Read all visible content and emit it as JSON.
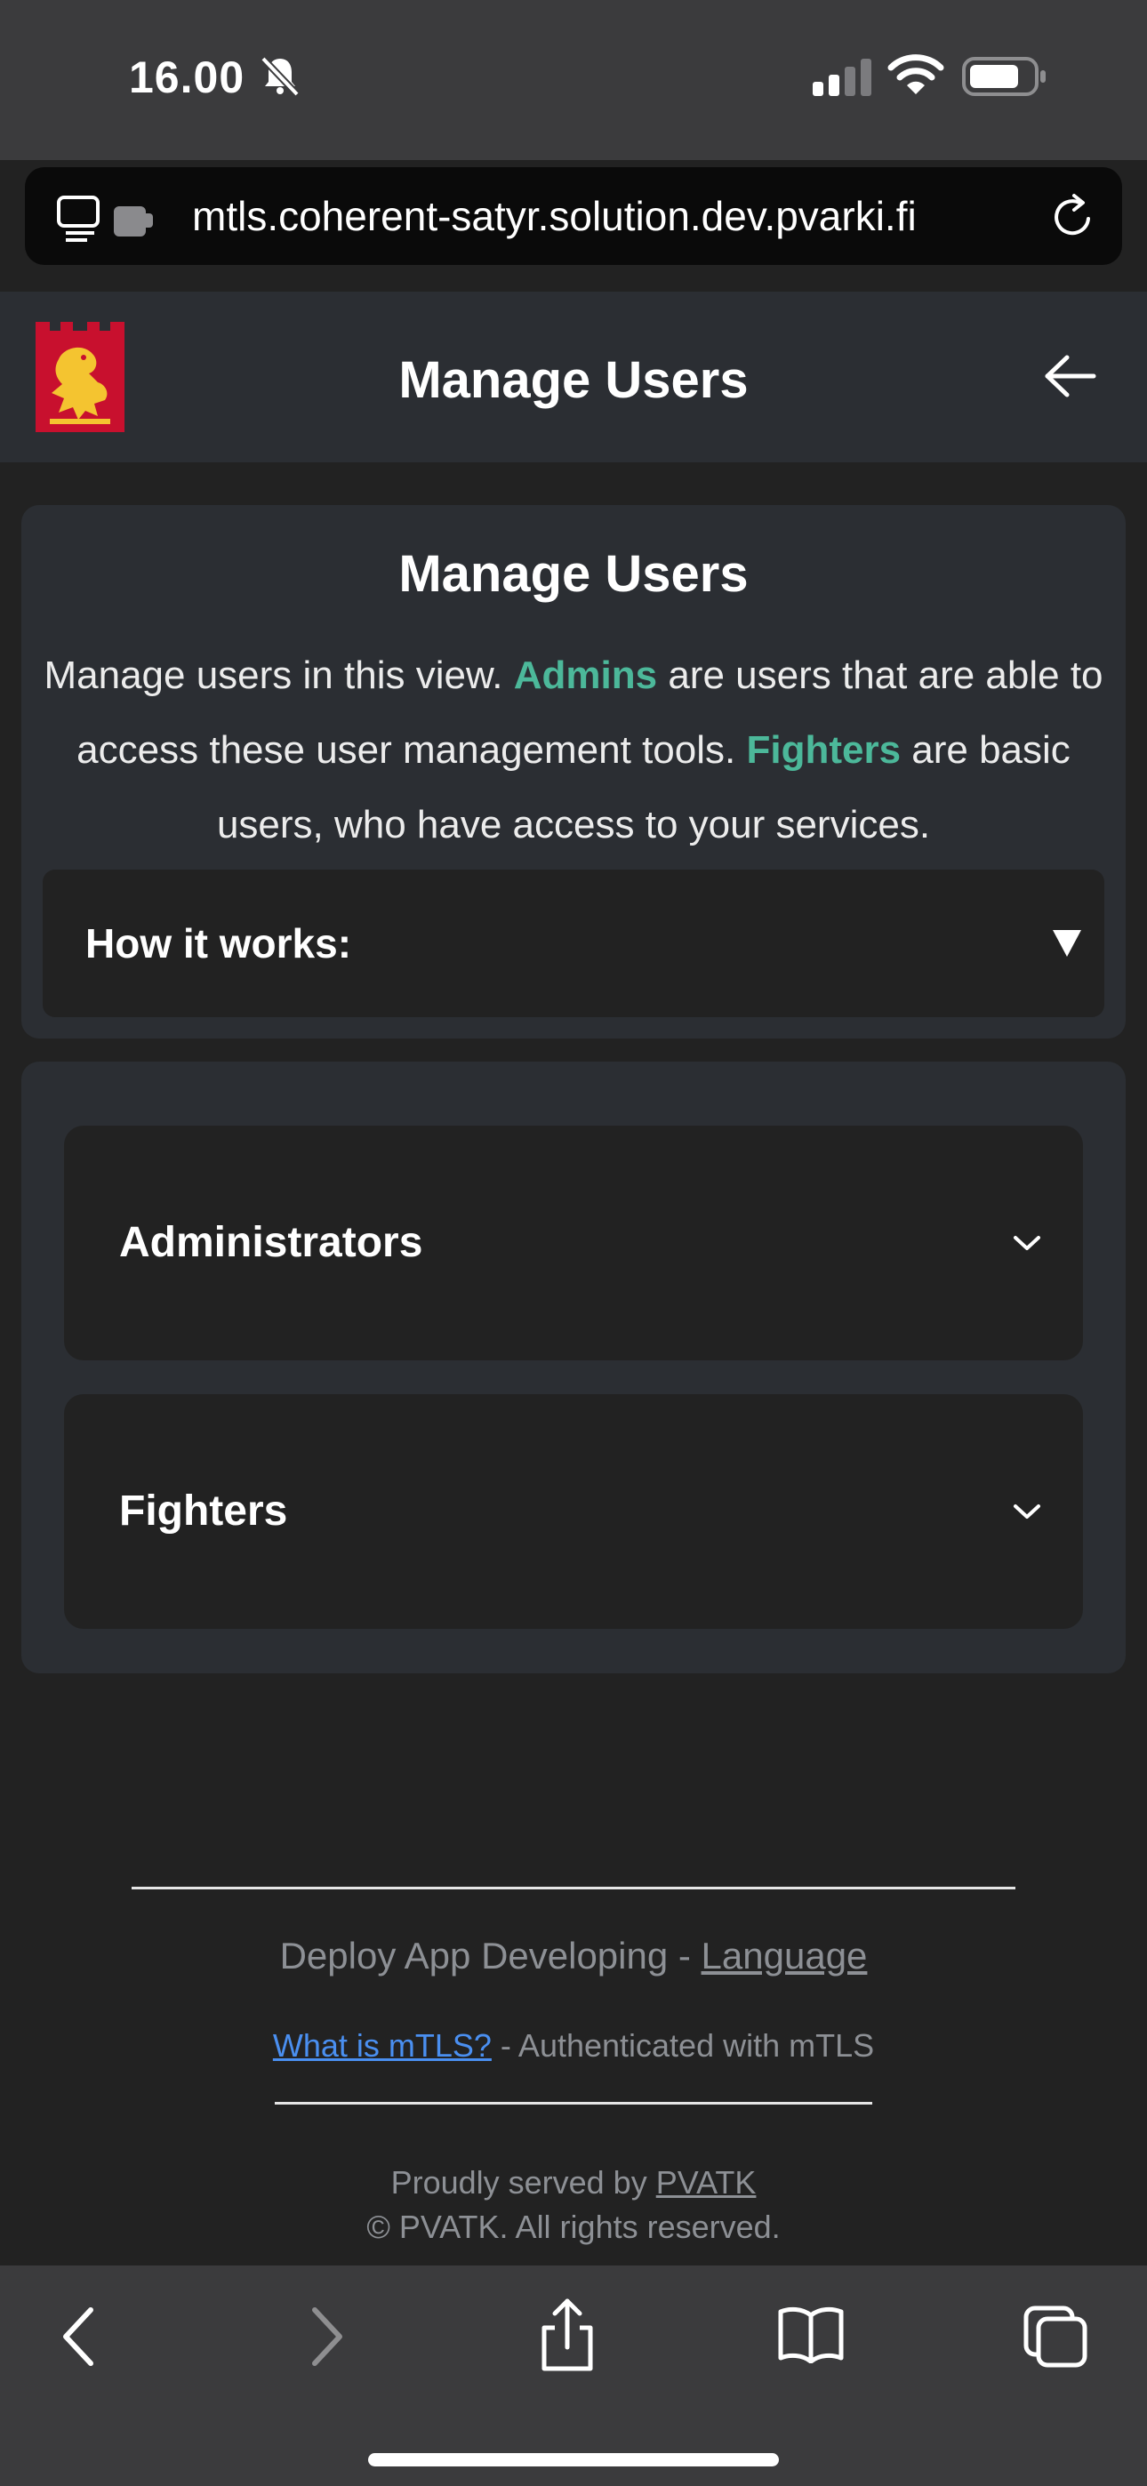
{
  "status_bar": {
    "time": "16.00"
  },
  "url_bar": {
    "url": "mtls.coherent-satyr.solution.dev.pvarki.fi"
  },
  "header": {
    "title": "Manage Users",
    "logo_icon": "lion-coat-of-arms-icon",
    "back_icon": "arrow-left-icon"
  },
  "intro": {
    "title": "Manage Users",
    "text_1": "Manage users in this view. ",
    "admins_term": "Admins",
    "text_2": " are users that are able to access these user management tools. ",
    "fighters_term": "Fighters",
    "text_3": " are basic users, who have access to your services.",
    "how_it_works_label": "How it works:"
  },
  "groups": [
    {
      "label": "Administrators"
    },
    {
      "label": "Fighters"
    }
  ],
  "footer": {
    "app_text": "Deploy App Developing - ",
    "language_link": "Language",
    "mtls_link": "What is mTLS?",
    "auth_text": " - Authenticated with mTLS",
    "served_by_text": "Proudly served by ",
    "pvatk_link": "PVATK",
    "copyright": "© PVATK. All rights reserved."
  },
  "colors": {
    "accent": "#4cb89a",
    "link": "#4a8ff0",
    "background": "#222222",
    "card": "#2b2e33"
  }
}
